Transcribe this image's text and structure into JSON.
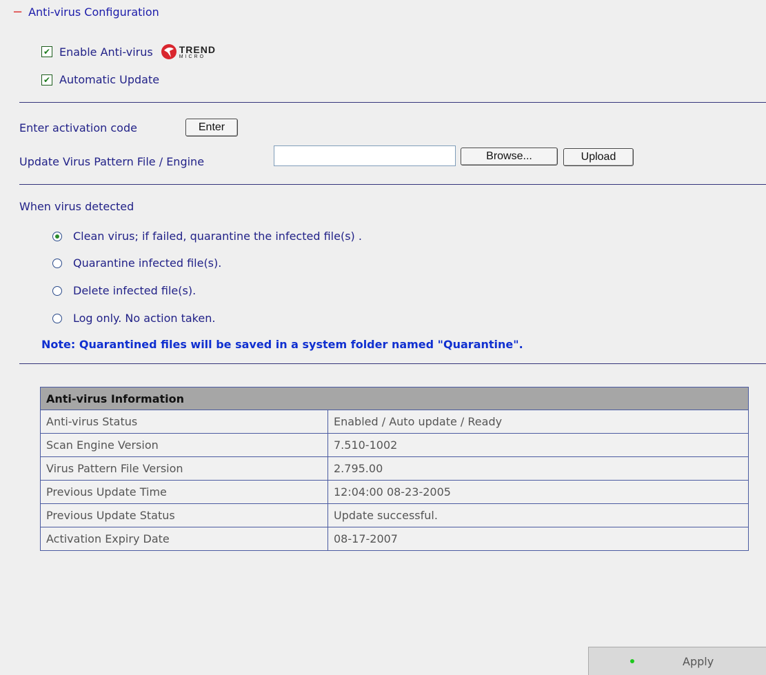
{
  "section": {
    "title": "Anti-virus Configuration",
    "collapse_symbol": "−"
  },
  "options": {
    "enable_antivirus": {
      "label": "Enable Anti-virus",
      "checked": true
    },
    "automatic_update": {
      "label": "Automatic Update",
      "checked": true
    },
    "logo": {
      "word": "TREND",
      "sub": "MICRO",
      "icon": "trend-micro-logo",
      "color": "#d9262e"
    }
  },
  "activation": {
    "label": "Enter activation code",
    "button": "Enter"
  },
  "pattern_update": {
    "label": "Update Virus Pattern File / Engine",
    "value": "",
    "browse_button": "Browse...",
    "upload_button": "Upload"
  },
  "virus_detected": {
    "heading": "When virus detected",
    "selected_index": 0,
    "choices": [
      "Clean virus; if failed, quarantine the infected file(s) .",
      "Quarantine infected file(s).",
      "Delete infected file(s).",
      "Log only. No action taken."
    ],
    "note": "Note: Quarantined files will be saved in a system folder named \"Quarantine\"."
  },
  "info_table": {
    "header": "Anti-virus Information",
    "rows": [
      {
        "key": "Anti-virus Status",
        "value": "Enabled / Auto update / Ready"
      },
      {
        "key": "Scan Engine Version",
        "value": "7.510-1002"
      },
      {
        "key": "Virus Pattern File Version",
        "value": "2.795.00"
      },
      {
        "key": "Previous Update Time",
        "value": "12:04:00 08-23-2005"
      },
      {
        "key": "Previous Update Status",
        "value": "Update successful."
      },
      {
        "key": "Activation Expiry Date",
        "value": "08-17-2007"
      }
    ]
  },
  "apply": {
    "label": "Apply",
    "indicator_color": "#1ec81e"
  }
}
